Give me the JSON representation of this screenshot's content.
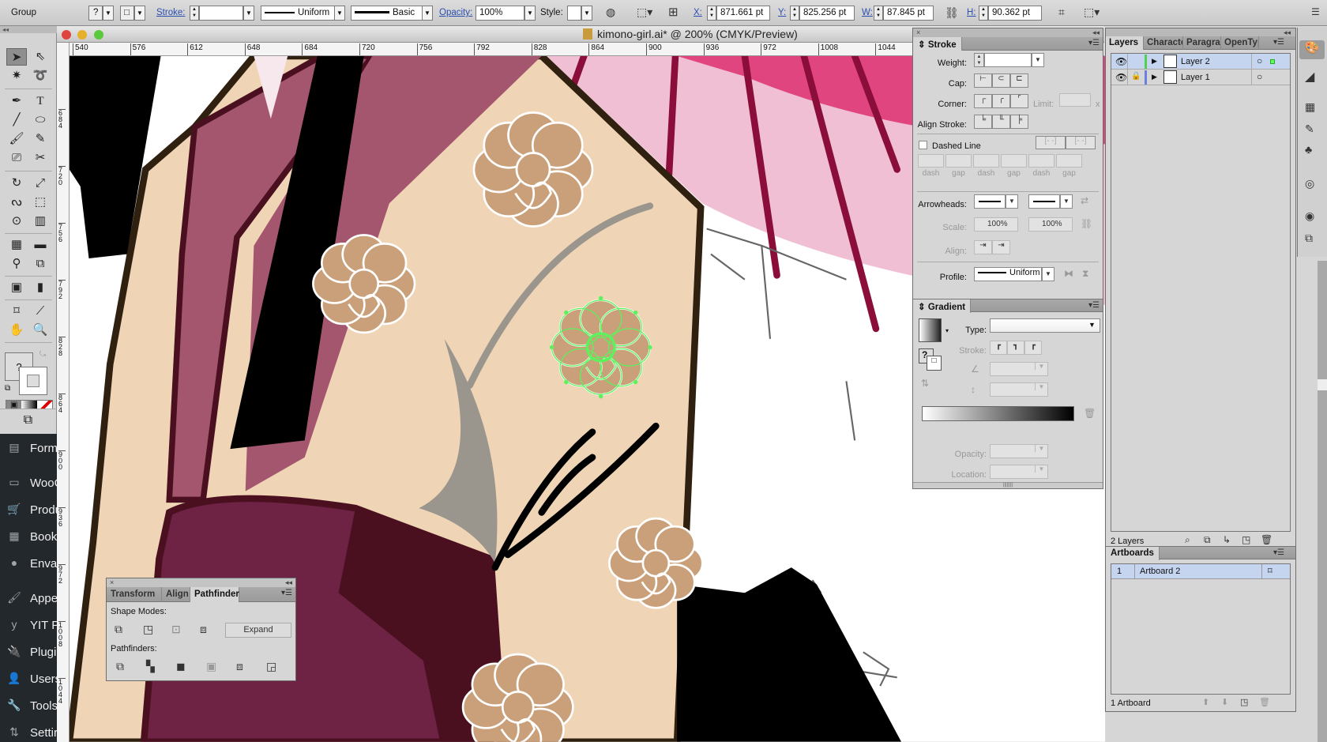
{
  "control_bar": {
    "selection_type": "Group",
    "fill_value": "?",
    "stroke_label": "Stroke:",
    "stroke_value": "",
    "variable_width_profile": "Uniform",
    "brush_definition": "Basic",
    "opacity_label": "Opacity:",
    "opacity_value": "100%",
    "style_label": "Style:",
    "x_label": "X:",
    "x_value": "871.661 pt",
    "y_label": "Y:",
    "y_value": "825.256 pt",
    "w_label": "W:",
    "w_value": "87.845 pt",
    "h_label": "H:",
    "h_value": "90.362 pt"
  },
  "document": {
    "title": "kimono-girl.ai* @ 200% (CMYK/Preview)",
    "h_ruler": [
      "540",
      "576",
      "612",
      "648",
      "684",
      "720",
      "756",
      "792",
      "828",
      "864",
      "900",
      "936",
      "972",
      "1008",
      "1044"
    ],
    "v_ruler": [
      "684",
      "720",
      "756",
      "792",
      "828",
      "864",
      "900",
      "936",
      "972",
      "1008",
      "1044"
    ]
  },
  "toolbox": {
    "fill_value": "?"
  },
  "wp_sidebar": {
    "items": [
      {
        "label": "Form",
        "icon": "forms-icon"
      },
      {
        "label": "WooC",
        "icon": "woo-icon"
      },
      {
        "label": "Produ",
        "icon": "cart-icon"
      },
      {
        "label": "Book",
        "icon": "calendar-icon"
      },
      {
        "label": "Envat",
        "icon": "envato-icon"
      },
      {
        "label": "Appe",
        "icon": "brush-icon"
      },
      {
        "label": "YIT Pl",
        "icon": "yit-icon"
      },
      {
        "label": "Plugi",
        "icon": "plug-icon"
      },
      {
        "label": "Users",
        "icon": "user-icon"
      },
      {
        "label": "Tools",
        "icon": "wrench-icon"
      },
      {
        "label": "Settir",
        "icon": "settings-icon"
      }
    ]
  },
  "stroke_panel": {
    "title": "Stroke",
    "weight_label": "Weight:",
    "weight_value": "",
    "cap_label": "Cap:",
    "corner_label": "Corner:",
    "limit_label": "Limit:",
    "limit_suffix": "x",
    "align_label": "Align Stroke:",
    "dashed_label": "Dashed Line",
    "dashed_checked": false,
    "dash_labels": [
      "dash",
      "gap",
      "dash",
      "gap",
      "dash",
      "gap"
    ],
    "arrowheads_label": "Arrowheads:",
    "scale_label": "Scale:",
    "scale_start": "100%",
    "scale_end": "100%",
    "arrow_align_label": "Align:",
    "profile_label": "Profile:",
    "profile_value": "Uniform"
  },
  "gradient_panel": {
    "title": "Gradient",
    "type_label": "Type:",
    "type_value": "",
    "stroke_label": "Stroke:",
    "fill_value": "?",
    "opacity_label": "Opacity:",
    "location_label": "Location:"
  },
  "layers_panel": {
    "tabs": [
      "Layers",
      "Characte",
      "Paragrap",
      "OpenTyp"
    ],
    "layers": [
      {
        "name": "Layer 2",
        "visible": true,
        "locked": false,
        "color": "#4fd14f",
        "selected": true
      },
      {
        "name": "Layer 1",
        "visible": true,
        "locked": true,
        "color": "#6b7fe0",
        "selected": false
      }
    ],
    "count": "2 Layers"
  },
  "artboards_panel": {
    "title": "Artboards",
    "items": [
      {
        "index": "1",
        "name": "Artboard 2"
      }
    ],
    "count": "1 Artboard"
  },
  "pathfinder_panel": {
    "tabs": [
      "Transform",
      "Align",
      "Pathfinder"
    ],
    "shape_modes_label": "Shape Modes:",
    "expand_label": "Expand",
    "pathfinders_label": "Pathfinders:"
  }
}
